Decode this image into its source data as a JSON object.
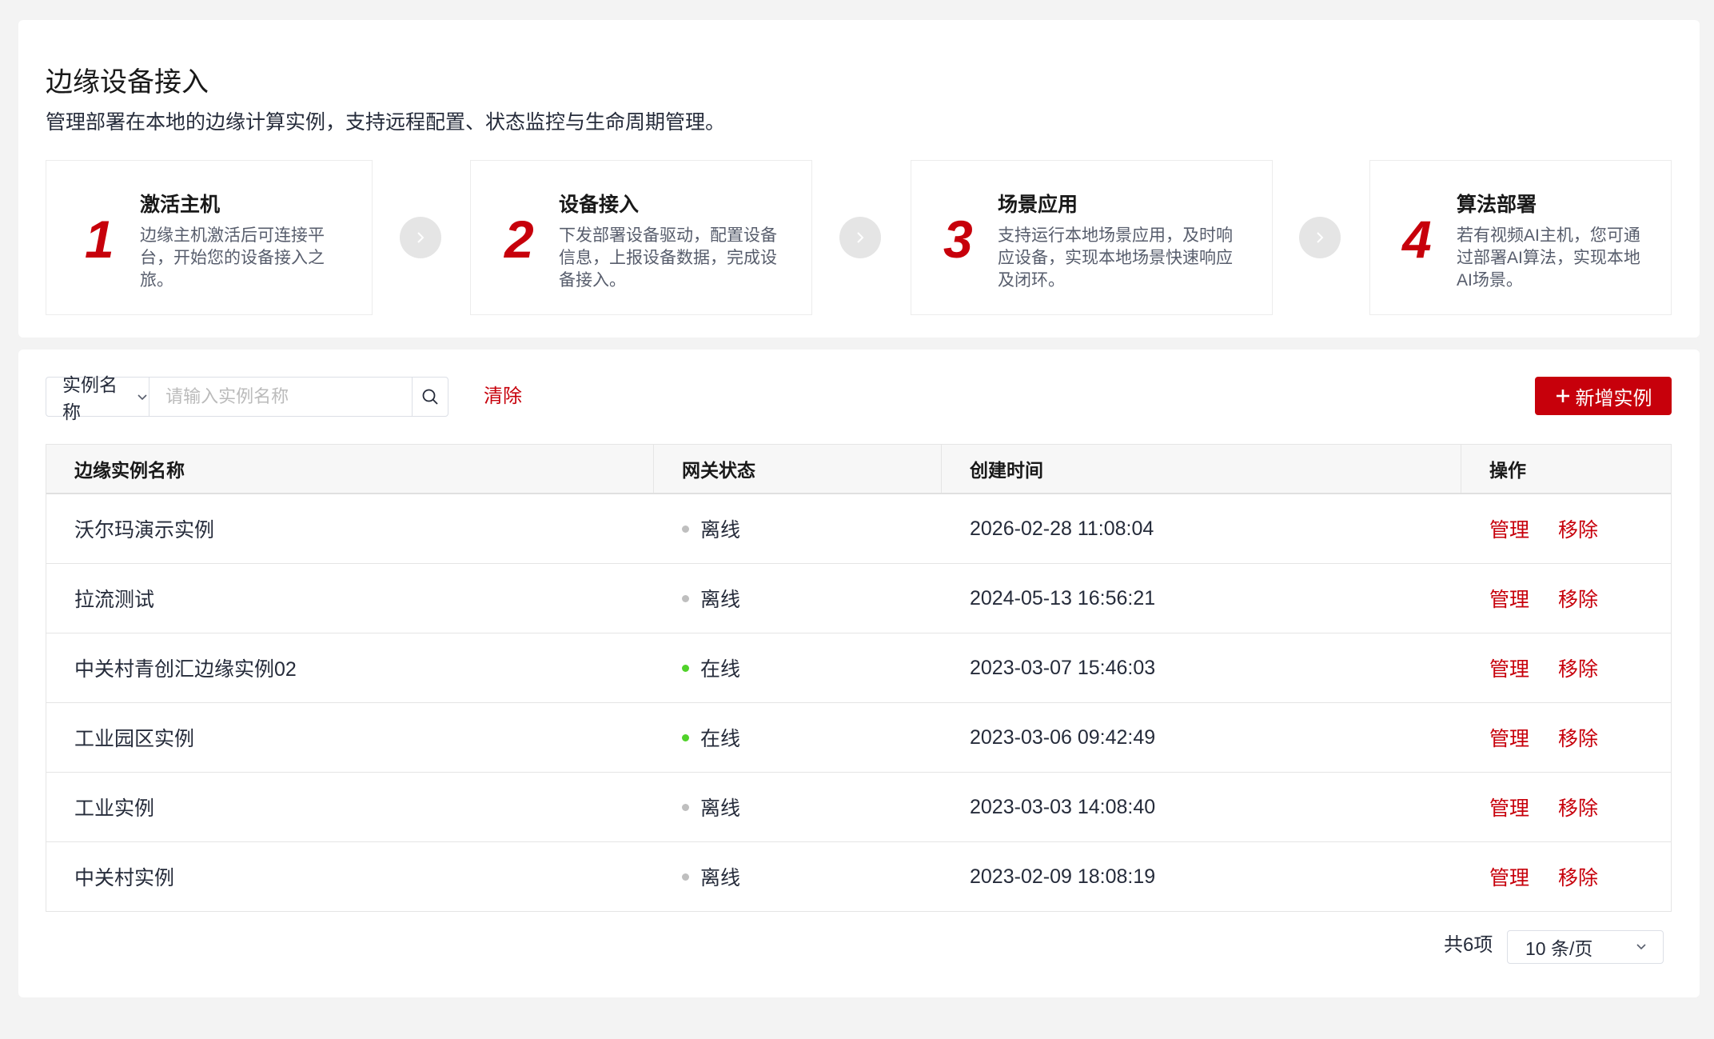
{
  "header": {
    "title": "边缘设备接入",
    "description": "管理部署在本地的边缘计算实例，支持远程配置、状态监控与生命周期管理。"
  },
  "steps": [
    {
      "number": "1",
      "title": "激活主机",
      "desc_lines": [
        "边缘主机激活后可连接平",
        "台，开始您的设备接入之",
        "旅。"
      ]
    },
    {
      "number": "2",
      "title": "设备接入",
      "desc_lines": [
        "下发部署设备驱动，配置设备",
        "信息，上报设备数据，完成设",
        "备接入。"
      ]
    },
    {
      "number": "3",
      "title": "场景应用",
      "desc_lines": [
        "支持运行本地场景应用，及时响",
        "应设备，实现本地场景快速响应",
        "及闭环。"
      ]
    },
    {
      "number": "4",
      "title": "算法部署",
      "desc_lines": [
        "若有视频AI主机，您可通",
        "过部署AI算法，实现本地",
        "AI场景。"
      ]
    }
  ],
  "toolbar": {
    "filter_field": "实例名称",
    "search_placeholder": "请输入实例名称",
    "clear_label": "清除",
    "add_label": "新增实例"
  },
  "table": {
    "columns": [
      "边缘实例名称",
      "网关状态",
      "创建时间",
      "操作"
    ],
    "rows": [
      {
        "name": "沃尔玛演示实例",
        "status": "离线",
        "created": "2026-02-28 11:08:04",
        "manage": "管理",
        "remove": "移除"
      },
      {
        "name": "拉流测试",
        "status": "离线",
        "created": "2024-05-13 16:56:21",
        "manage": "管理",
        "remove": "移除"
      },
      {
        "name": "中关村青创汇边缘实例02",
        "status": "在线",
        "created": "2023-03-07 15:46:03",
        "manage": "管理",
        "remove": "移除"
      },
      {
        "name": "工业园区实例",
        "status": "在线",
        "created": "2023-03-06 09:42:49",
        "manage": "管理",
        "remove": "移除"
      },
      {
        "name": "工业实例",
        "status": "离线",
        "created": "2023-03-03 14:08:40",
        "manage": "管理",
        "remove": "移除"
      },
      {
        "name": "中关村实例",
        "status": "离线",
        "created": "2023-02-09 18:08:19",
        "manage": "管理",
        "remove": "移除"
      }
    ]
  },
  "pagination": {
    "total": "共6项",
    "page_size": "10 条/页"
  },
  "colors": {
    "accent": "#c7000b",
    "online": "#50d22a",
    "offline": "#bfbfbf"
  }
}
